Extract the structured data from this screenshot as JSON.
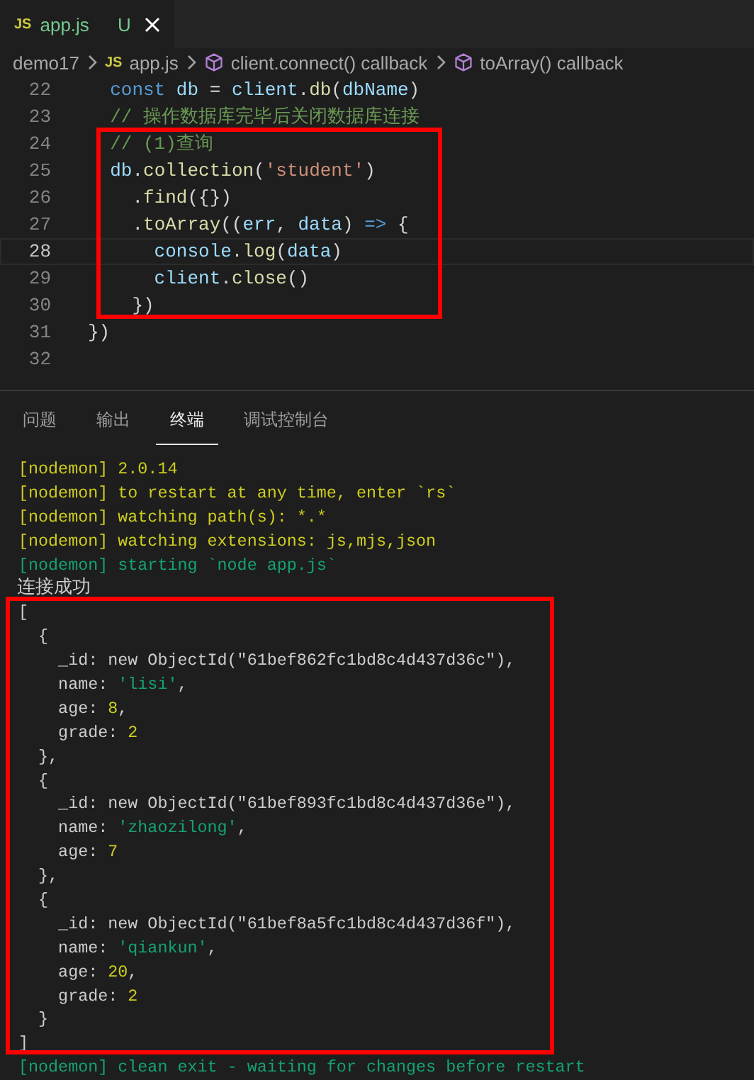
{
  "editor_tabs": [
    {
      "icon_text": "JS",
      "label": "app.js",
      "status": "U",
      "selected": true
    }
  ],
  "breadcrumbs": [
    {
      "kind": "folder",
      "label": "demo17"
    },
    {
      "kind": "file",
      "icon_text": "JS",
      "label": "app.js"
    },
    {
      "kind": "symbol",
      "label": "client.connect() callback"
    },
    {
      "kind": "symbol",
      "label": "toArray() callback"
    }
  ],
  "code_lines": [
    {
      "number": "22",
      "current": false,
      "tokens": [
        {
          "text": "  const",
          "kind": "keyword"
        },
        {
          "text": " db ",
          "kind": "variable"
        },
        {
          "text": "= ",
          "kind": "plain"
        },
        {
          "text": "client",
          "kind": "variable"
        },
        {
          "text": ".",
          "kind": "plain"
        },
        {
          "text": "db",
          "kind": "function"
        },
        {
          "text": "(",
          "kind": "plain"
        },
        {
          "text": "dbName",
          "kind": "variable"
        },
        {
          "text": ")",
          "kind": "plain"
        }
      ]
    },
    {
      "number": "23",
      "current": false,
      "tokens": [
        {
          "text": "  // 操作数据库完毕后关闭数据库连接",
          "kind": "comment"
        }
      ]
    },
    {
      "number": "24",
      "current": false,
      "tokens": [
        {
          "text": "  // (1)查询",
          "kind": "comment"
        }
      ]
    },
    {
      "number": "25",
      "current": false,
      "tokens": [
        {
          "text": "  db",
          "kind": "variable"
        },
        {
          "text": ".",
          "kind": "plain"
        },
        {
          "text": "collection",
          "kind": "function"
        },
        {
          "text": "(",
          "kind": "plain"
        },
        {
          "text": "'student'",
          "kind": "string"
        },
        {
          "text": ")",
          "kind": "plain"
        }
      ]
    },
    {
      "number": "26",
      "current": false,
      "tokens": [
        {
          "text": "    .",
          "kind": "plain"
        },
        {
          "text": "find",
          "kind": "function"
        },
        {
          "text": "({})",
          "kind": "plain"
        }
      ]
    },
    {
      "number": "27",
      "current": false,
      "tokens": [
        {
          "text": "    .",
          "kind": "plain"
        },
        {
          "text": "toArray",
          "kind": "function"
        },
        {
          "text": "((",
          "kind": "plain"
        },
        {
          "text": "err",
          "kind": "variable"
        },
        {
          "text": ", ",
          "kind": "plain"
        },
        {
          "text": "data",
          "kind": "variable"
        },
        {
          "text": ") ",
          "kind": "plain"
        },
        {
          "text": "=>",
          "kind": "keyword"
        },
        {
          "text": " {",
          "kind": "plain"
        }
      ]
    },
    {
      "number": "28",
      "current": true,
      "tokens": [
        {
          "text": "      console",
          "kind": "variable"
        },
        {
          "text": ".",
          "kind": "plain"
        },
        {
          "text": "log",
          "kind": "function"
        },
        {
          "text": "(",
          "kind": "plain"
        },
        {
          "text": "data",
          "kind": "variable"
        },
        {
          "text": ")",
          "kind": "plain"
        }
      ]
    },
    {
      "number": "29",
      "current": false,
      "tokens": [
        {
          "text": "      client",
          "kind": "variable"
        },
        {
          "text": ".",
          "kind": "plain"
        },
        {
          "text": "close",
          "kind": "function"
        },
        {
          "text": "()",
          "kind": "plain"
        }
      ]
    },
    {
      "number": "30",
      "current": false,
      "tokens": [
        {
          "text": "    })",
          "kind": "plain"
        }
      ]
    },
    {
      "number": "31",
      "current": false,
      "tokens": [
        {
          "text": "})",
          "kind": "plain"
        }
      ]
    },
    {
      "number": "32",
      "current": false
    }
  ],
  "panel_tabs": [
    {
      "label": "问题",
      "selected": false
    },
    {
      "label": "输出",
      "selected": false
    },
    {
      "label": "终端",
      "selected": true
    },
    {
      "label": "调试控制台",
      "selected": false
    }
  ],
  "terminal_lines": [
    [
      {
        "text": "[nodemon] 2.0.14",
        "kind": "warning"
      }
    ],
    [
      {
        "text": "[nodemon] to restart at any time, enter `rs`",
        "kind": "warning"
      }
    ],
    [
      {
        "text": "[nodemon] watching path(s): *.*",
        "kind": "warning"
      }
    ],
    [
      {
        "text": "[nodemon] watching extensions: js,mjs,json",
        "kind": "warning"
      }
    ],
    [
      {
        "text": "[nodemon] starting `node app.js`",
        "kind": "info"
      }
    ],
    [
      {
        "text": "连接成功",
        "kind": "plain"
      }
    ],
    [
      {
        "text": "[",
        "kind": "plain"
      }
    ],
    [
      {
        "text": "  {",
        "kind": "plain"
      }
    ],
    [
      {
        "text": "    _id: new ObjectId(\"61bef862fc1bd8c4d437d36c\"),",
        "kind": "plain"
      }
    ],
    [
      {
        "text": "    name: ",
        "kind": "plain"
      },
      {
        "text": "'lisi'",
        "kind": "string"
      },
      {
        "text": ",",
        "kind": "plain"
      }
    ],
    [
      {
        "text": "    age: ",
        "kind": "plain"
      },
      {
        "text": "8",
        "kind": "number"
      },
      {
        "text": ",",
        "kind": "plain"
      }
    ],
    [
      {
        "text": "    grade: ",
        "kind": "plain"
      },
      {
        "text": "2",
        "kind": "number"
      }
    ],
    [
      {
        "text": "  },",
        "kind": "plain"
      }
    ],
    [
      {
        "text": "  {",
        "kind": "plain"
      }
    ],
    [
      {
        "text": "    _id: new ObjectId(\"61bef893fc1bd8c4d437d36e\"),",
        "kind": "plain"
      }
    ],
    [
      {
        "text": "    name: ",
        "kind": "plain"
      },
      {
        "text": "'zhaozilong'",
        "kind": "string"
      },
      {
        "text": ",",
        "kind": "plain"
      }
    ],
    [
      {
        "text": "    age: ",
        "kind": "plain"
      },
      {
        "text": "7",
        "kind": "number"
      }
    ],
    [
      {
        "text": "  },",
        "kind": "plain"
      }
    ],
    [
      {
        "text": "  {",
        "kind": "plain"
      }
    ],
    [
      {
        "text": "    _id: new ObjectId(\"61bef8a5fc1bd8c4d437d36f\"),",
        "kind": "plain"
      }
    ],
    [
      {
        "text": "    name: ",
        "kind": "plain"
      },
      {
        "text": "'qiankun'",
        "kind": "string"
      },
      {
        "text": ",",
        "kind": "plain"
      }
    ],
    [
      {
        "text": "    age: ",
        "kind": "plain"
      },
      {
        "text": "20",
        "kind": "number"
      },
      {
        "text": ",",
        "kind": "plain"
      }
    ],
    [
      {
        "text": "    grade: ",
        "kind": "plain"
      },
      {
        "text": "2",
        "kind": "number"
      }
    ],
    [
      {
        "text": "  }",
        "kind": "plain"
      }
    ],
    [
      {
        "text": "]",
        "kind": "plain"
      }
    ],
    [
      {
        "text": "[nodemon] clean exit - waiting for changes before restart",
        "kind": "info"
      }
    ]
  ]
}
